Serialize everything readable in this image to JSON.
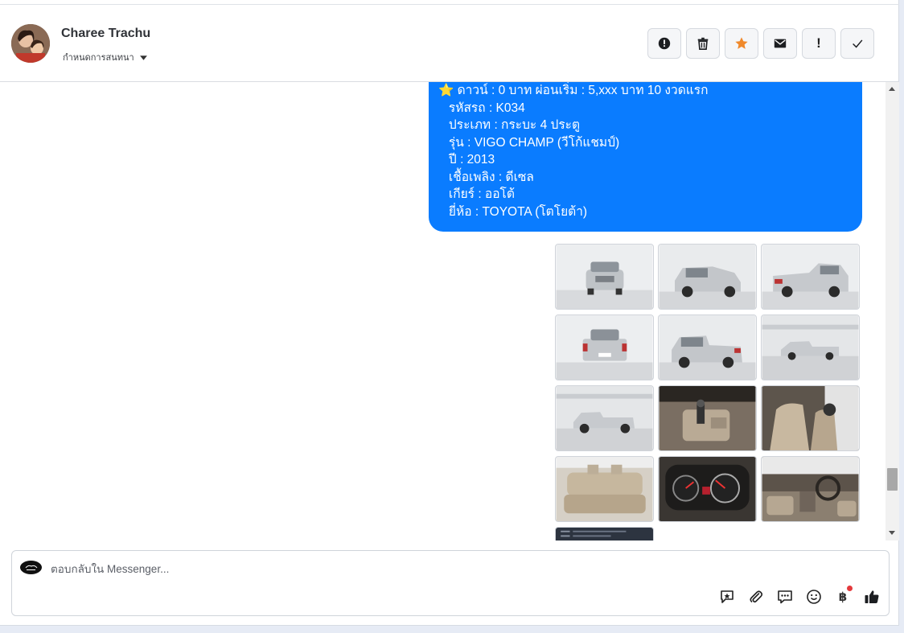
{
  "header": {
    "contact_name": "Charee Trachu",
    "assign_label": "กำหนดการสนทนา",
    "actions": [
      {
        "name": "info-button",
        "icon": "info-icon"
      },
      {
        "name": "delete-button",
        "icon": "trash-icon"
      },
      {
        "name": "star-button",
        "icon": "star-icon"
      },
      {
        "name": "mark-unread-button",
        "icon": "envelope-icon"
      },
      {
        "name": "important-button",
        "icon": "exclamation-icon",
        "label": "!"
      },
      {
        "name": "done-button",
        "icon": "check-icon"
      }
    ]
  },
  "message": {
    "lines": [
      "⭐ ดาวน์ : 0 บาท ผ่อนเริ่ม : 5,xxx บาท 10 งวดแรก",
      "   รหัสรถ : K034",
      "   ประเภท : กระบะ 4 ประตู",
      "   รุ่น : VIGO CHAMP (วีโก้แชมป์)",
      "   ปี : 2013",
      "   เชื้อเพลิง : ดีเซล",
      "   เกียร์ : ออโต้",
      "   ยี่ห้อ : TOYOTA (โตโยต้า)"
    ]
  },
  "gallery": {
    "photos": [
      {
        "desc": "front-view"
      },
      {
        "desc": "front-quarter-view"
      },
      {
        "desc": "rear-quarter-view"
      },
      {
        "desc": "rear-view"
      },
      {
        "desc": "rear-left-quarter-view"
      },
      {
        "desc": "side-view-far"
      },
      {
        "desc": "side-view"
      },
      {
        "desc": "center-console"
      },
      {
        "desc": "front-seats"
      },
      {
        "desc": "rear-seats"
      },
      {
        "desc": "gauge-cluster"
      },
      {
        "desc": "dashboard"
      }
    ]
  },
  "composer": {
    "placeholder": "ตอบกลับใน Messenger...",
    "tools": [
      "saved-reply-icon",
      "attachment-icon",
      "chat-bubbles-icon",
      "emoji-icon",
      "baht-icon",
      "thumbs-up-icon"
    ],
    "baht_symbol": "฿"
  },
  "colors": {
    "bubble": "#0a7cff",
    "star": "#f0892b"
  }
}
